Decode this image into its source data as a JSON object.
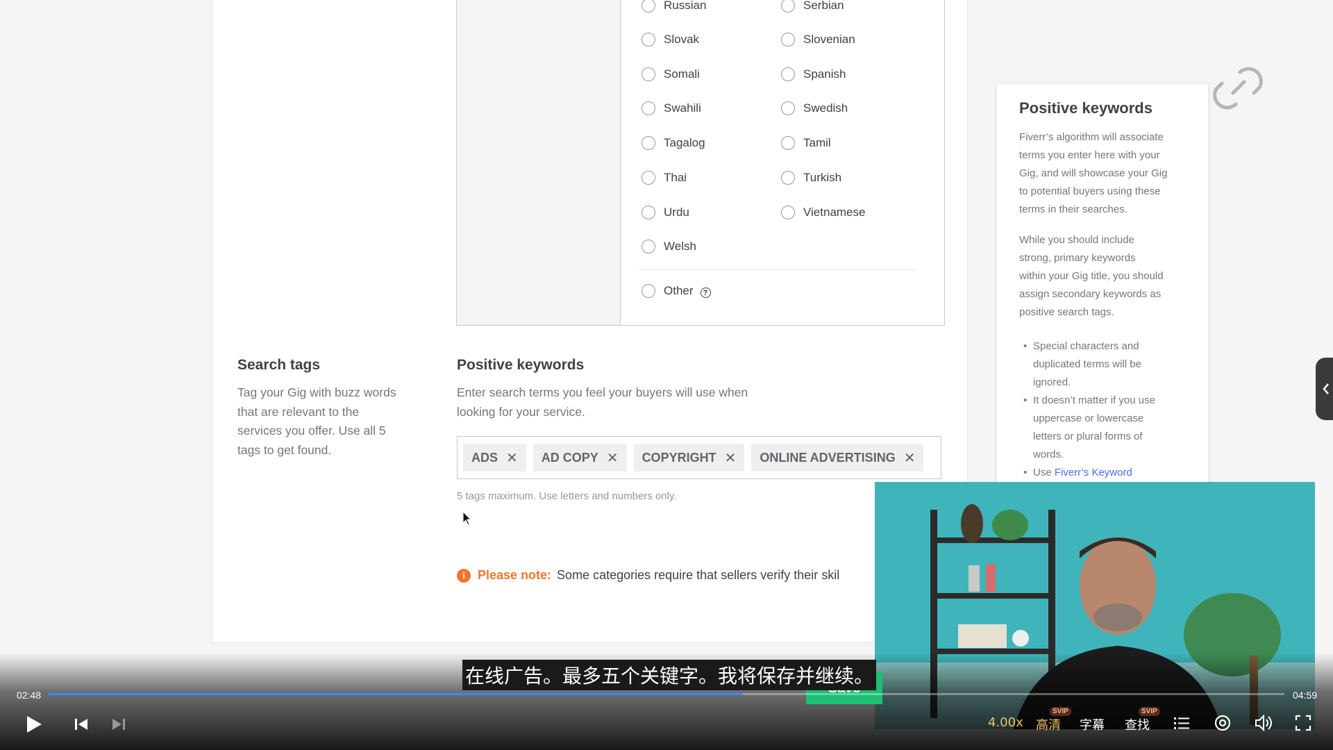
{
  "languages": {
    "col1": [
      "Russian",
      "Slovak",
      "Somali",
      "Swahili",
      "Tagalog",
      "Thai",
      "Urdu",
      "Welsh"
    ],
    "col2": [
      "Serbian",
      "Slovenian",
      "Spanish",
      "Swedish",
      "Tamil",
      "Turkish",
      "Vietnamese"
    ],
    "other": "Other",
    "help_glyph": "?"
  },
  "search_tags": {
    "title": "Search tags",
    "desc_lines": [
      "Tag your Gig with buzz words",
      "that are relevant to the",
      "services you offer. Use all 5",
      "tags to get found."
    ]
  },
  "positive_keywords": {
    "title": "Positive keywords",
    "desc_lines": [
      "Enter search terms you feel your buyers will use when",
      "looking for your service."
    ],
    "tags": [
      "ADS",
      "AD COPY",
      "COPYRIGHT",
      "ONLINE ADVERTISING"
    ],
    "remove_glyph": "✕",
    "hint": "5 tags maximum. Use letters and numbers only."
  },
  "note": {
    "icon": "i",
    "label": "Please note:",
    "text": "Some categories require that sellers verify their skil"
  },
  "tip": {
    "title": "Positive keywords",
    "p1_lines": [
      "Fiverr’s algorithm will associate",
      "terms you enter here with your",
      "Gig, and will showcase your Gig",
      "to potential buyers using these",
      "terms in their searches."
    ],
    "p2_lines": [
      "While you should include",
      "strong, primary keywords",
      "within your Gig title, you should",
      "assign secondary keywords as",
      "positive search tags."
    ],
    "bullets": [
      [
        "Special characters and",
        "duplicated terms will be",
        "ignored."
      ],
      [
        "It doesn’t matter if you use",
        "uppercase or lowercase",
        "letters or plural forms of",
        "words."
      ]
    ],
    "bullet3_text": "Use ",
    "bullet3_link": "Fiverr’s Keyword"
  },
  "video": {
    "subtitle": "在线广告。最多五个关键字。我将保存并继续。",
    "save_partial": "Save",
    "current_time": "02:48",
    "total_time": "04:59",
    "progress": 0.5618,
    "speed": "4.00x",
    "quality": "高清",
    "captions": "字幕",
    "search": "查找",
    "badge": "SVIP"
  },
  "colors": {
    "accent_orange": "#f1762b",
    "link_blue": "#446ee7",
    "progress_blue": "#2f8cff",
    "save_green": "#1dbf73"
  },
  "icons": [
    "help-icon",
    "close-icon",
    "info-icon",
    "link-icon",
    "chevron-left-icon",
    "play-icon",
    "skip-previous-icon",
    "skip-next-icon",
    "playlist-icon",
    "settings-icon",
    "volume-icon",
    "fullscreen-icon",
    "cursor-icon"
  ]
}
